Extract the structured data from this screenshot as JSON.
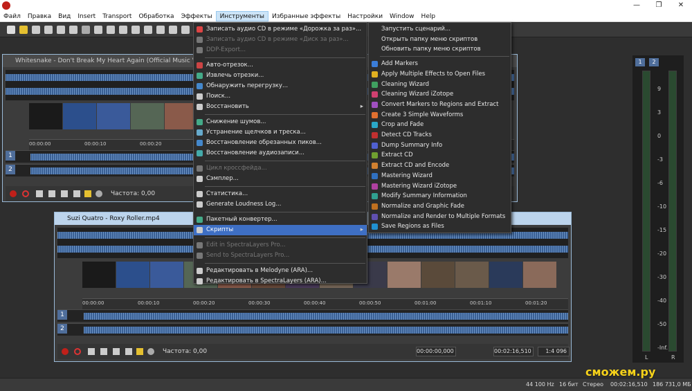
{
  "menubar": [
    "Файл",
    "Правка",
    "Вид",
    "Insert",
    "Transport",
    "Обработка",
    "Эффекты",
    "Инструменты",
    "Избранные эффекты",
    "Настройки",
    "Window",
    "Help"
  ],
  "menu_tools": [
    {
      "label": "Записать аудио CD в режиме «Дорожка за раз»...",
      "enabled": true
    },
    {
      "label": "Записать аудио CD в режиме «Диск за раз»...",
      "enabled": false
    },
    {
      "label": "DDP-Export...",
      "enabled": false
    },
    {
      "label": "Авто-отрезок...",
      "enabled": true
    },
    {
      "label": "Извлечь отрезки...",
      "enabled": true
    },
    {
      "label": "Обнаружить перегрузку...",
      "enabled": true
    },
    {
      "label": "Поиск...",
      "enabled": true
    },
    {
      "label": "Восстановить",
      "enabled": true
    },
    {
      "label": "Снижение шумов...",
      "enabled": true
    },
    {
      "label": "Устранение щелчков и треска...",
      "enabled": true
    },
    {
      "label": "Восстановление обрезанных пиков...",
      "enabled": true
    },
    {
      "label": "Восстановление аудиозаписи...",
      "enabled": true
    },
    {
      "label": "Цикл кроссфейда...",
      "enabled": false
    },
    {
      "label": "Сэмплер...",
      "enabled": true
    },
    {
      "label": "Статистика...",
      "enabled": true
    },
    {
      "label": "Generate Loudness Log...",
      "enabled": true
    },
    {
      "label": "Пакетный конвертер...",
      "enabled": true
    },
    {
      "label": "Скрипты",
      "enabled": true
    },
    {
      "label": "Edit in SpectraLayers Pro...",
      "enabled": false
    },
    {
      "label": "Send to SpectraLayers Pro...",
      "enabled": false
    },
    {
      "label": "Редактировать в Melodyne (ARA)...",
      "enabled": true
    },
    {
      "label": "Редактировать в SpectraLayers (ARA)...",
      "enabled": true
    }
  ],
  "menu_scripts": [
    "Запустить сценарий...",
    "Открыть папку меню скриптов",
    "Обновить папку меню скриптов",
    "Add Markers",
    "Apply Multiple Effects to Open Files",
    "Cleaning Wizard",
    "Cleaning Wizard iZotope",
    "Convert Markers to Regions and Extract",
    "Create 3 Simple Waveforms",
    "Crop and Fade",
    "Detect CD Tracks",
    "Dump Summary Info",
    "Extract CD",
    "Extract CD and Encode",
    "Mastering Wizard",
    "Mastering Wizard iZotope",
    "Modify Summary Information",
    "Normalize and Graphic Fade",
    "Normalize and Render to Multiple Formats",
    "Save Regions as Files"
  ],
  "doc1": {
    "title": "Whitesnake - Don't Break My Heart Again (Official Music Video).m",
    "ticks": [
      "00:00:00",
      "00:00:10",
      "00:00:20"
    ],
    "freq_label": "Частота: 0,00"
  },
  "doc2": {
    "title": "Suzi Quatro - Roxy Roller.mp4",
    "ticks": [
      "00:00:00",
      "00:00:10",
      "00:00:20",
      "00:00:30",
      "00:00:40",
      "00:00:50",
      "00:01:00",
      "00:01:10",
      "00:01:20"
    ],
    "freq_label": "Частота: 0,00",
    "time_pos": "00:00:00,000",
    "time_len": "00:02:16,510",
    "zoom": "1:4 096"
  },
  "meter": {
    "ch1": "1",
    "ch2": "2",
    "scale": [
      "9",
      "3",
      "0",
      "-3",
      "-6",
      "-10",
      "-15",
      "-20",
      "-30",
      "-40",
      "-50",
      "-Inf."
    ],
    "left": "L",
    "right": "R"
  },
  "status": {
    "rate": "44 100 Hz",
    "bits": "16 бит",
    "mode": "Стерео",
    "length": "00:02:16,510",
    "free": "186 731,0 МБ"
  },
  "watermark": "сможем.ру",
  "colors": {
    "accent": "#3e6fc4",
    "wave": "#7aa7e0"
  }
}
